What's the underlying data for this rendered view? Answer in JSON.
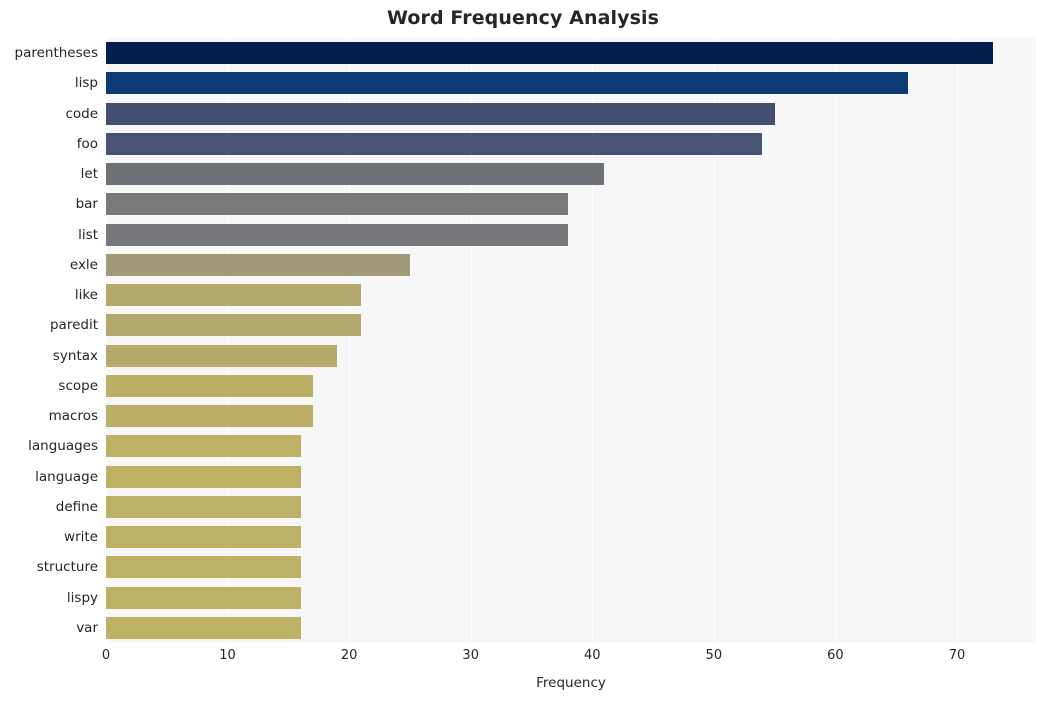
{
  "chart_data": {
    "type": "bar",
    "orientation": "horizontal",
    "title": "Word Frequency Analysis",
    "xlabel": "Frequency",
    "ylabel": "",
    "xlim": [
      0,
      76.5
    ],
    "xticks": [
      0,
      10,
      20,
      30,
      40,
      50,
      60,
      70
    ],
    "xtick_labels": [
      "0",
      "10",
      "20",
      "30",
      "40",
      "50",
      "60",
      "70"
    ],
    "grid": true,
    "grid_axis": "x",
    "legend": "none",
    "categories": [
      "parentheses",
      "lisp",
      "code",
      "foo",
      "let",
      "bar",
      "list",
      "exle",
      "like",
      "paredit",
      "syntax",
      "scope",
      "macros",
      "languages",
      "language",
      "define",
      "write",
      "structure",
      "lispy",
      "var"
    ],
    "values": [
      73,
      66,
      55,
      54,
      41,
      38,
      38,
      25,
      21,
      21,
      19,
      17,
      17,
      16,
      16,
      16,
      16,
      16,
      16,
      16
    ],
    "bar_colors": [
      "#03214c",
      "#0c3a74",
      "#454f6f",
      "#4a5474",
      "#6e7176",
      "#78797b",
      "#76787b",
      "#a09a79",
      "#b3a96c",
      "#b3a96c",
      "#b6ab6a",
      "#bbaf67",
      "#bbaf67",
      "#bdb166",
      "#bdb166",
      "#bdb166",
      "#bdb166",
      "#bdb166",
      "#bdb166",
      "#bdb166"
    ],
    "plot_background": "#f7f7f7",
    "figure_background": "#ffffff",
    "gridline_color": "#ffffff",
    "text_color": "#262626"
  }
}
